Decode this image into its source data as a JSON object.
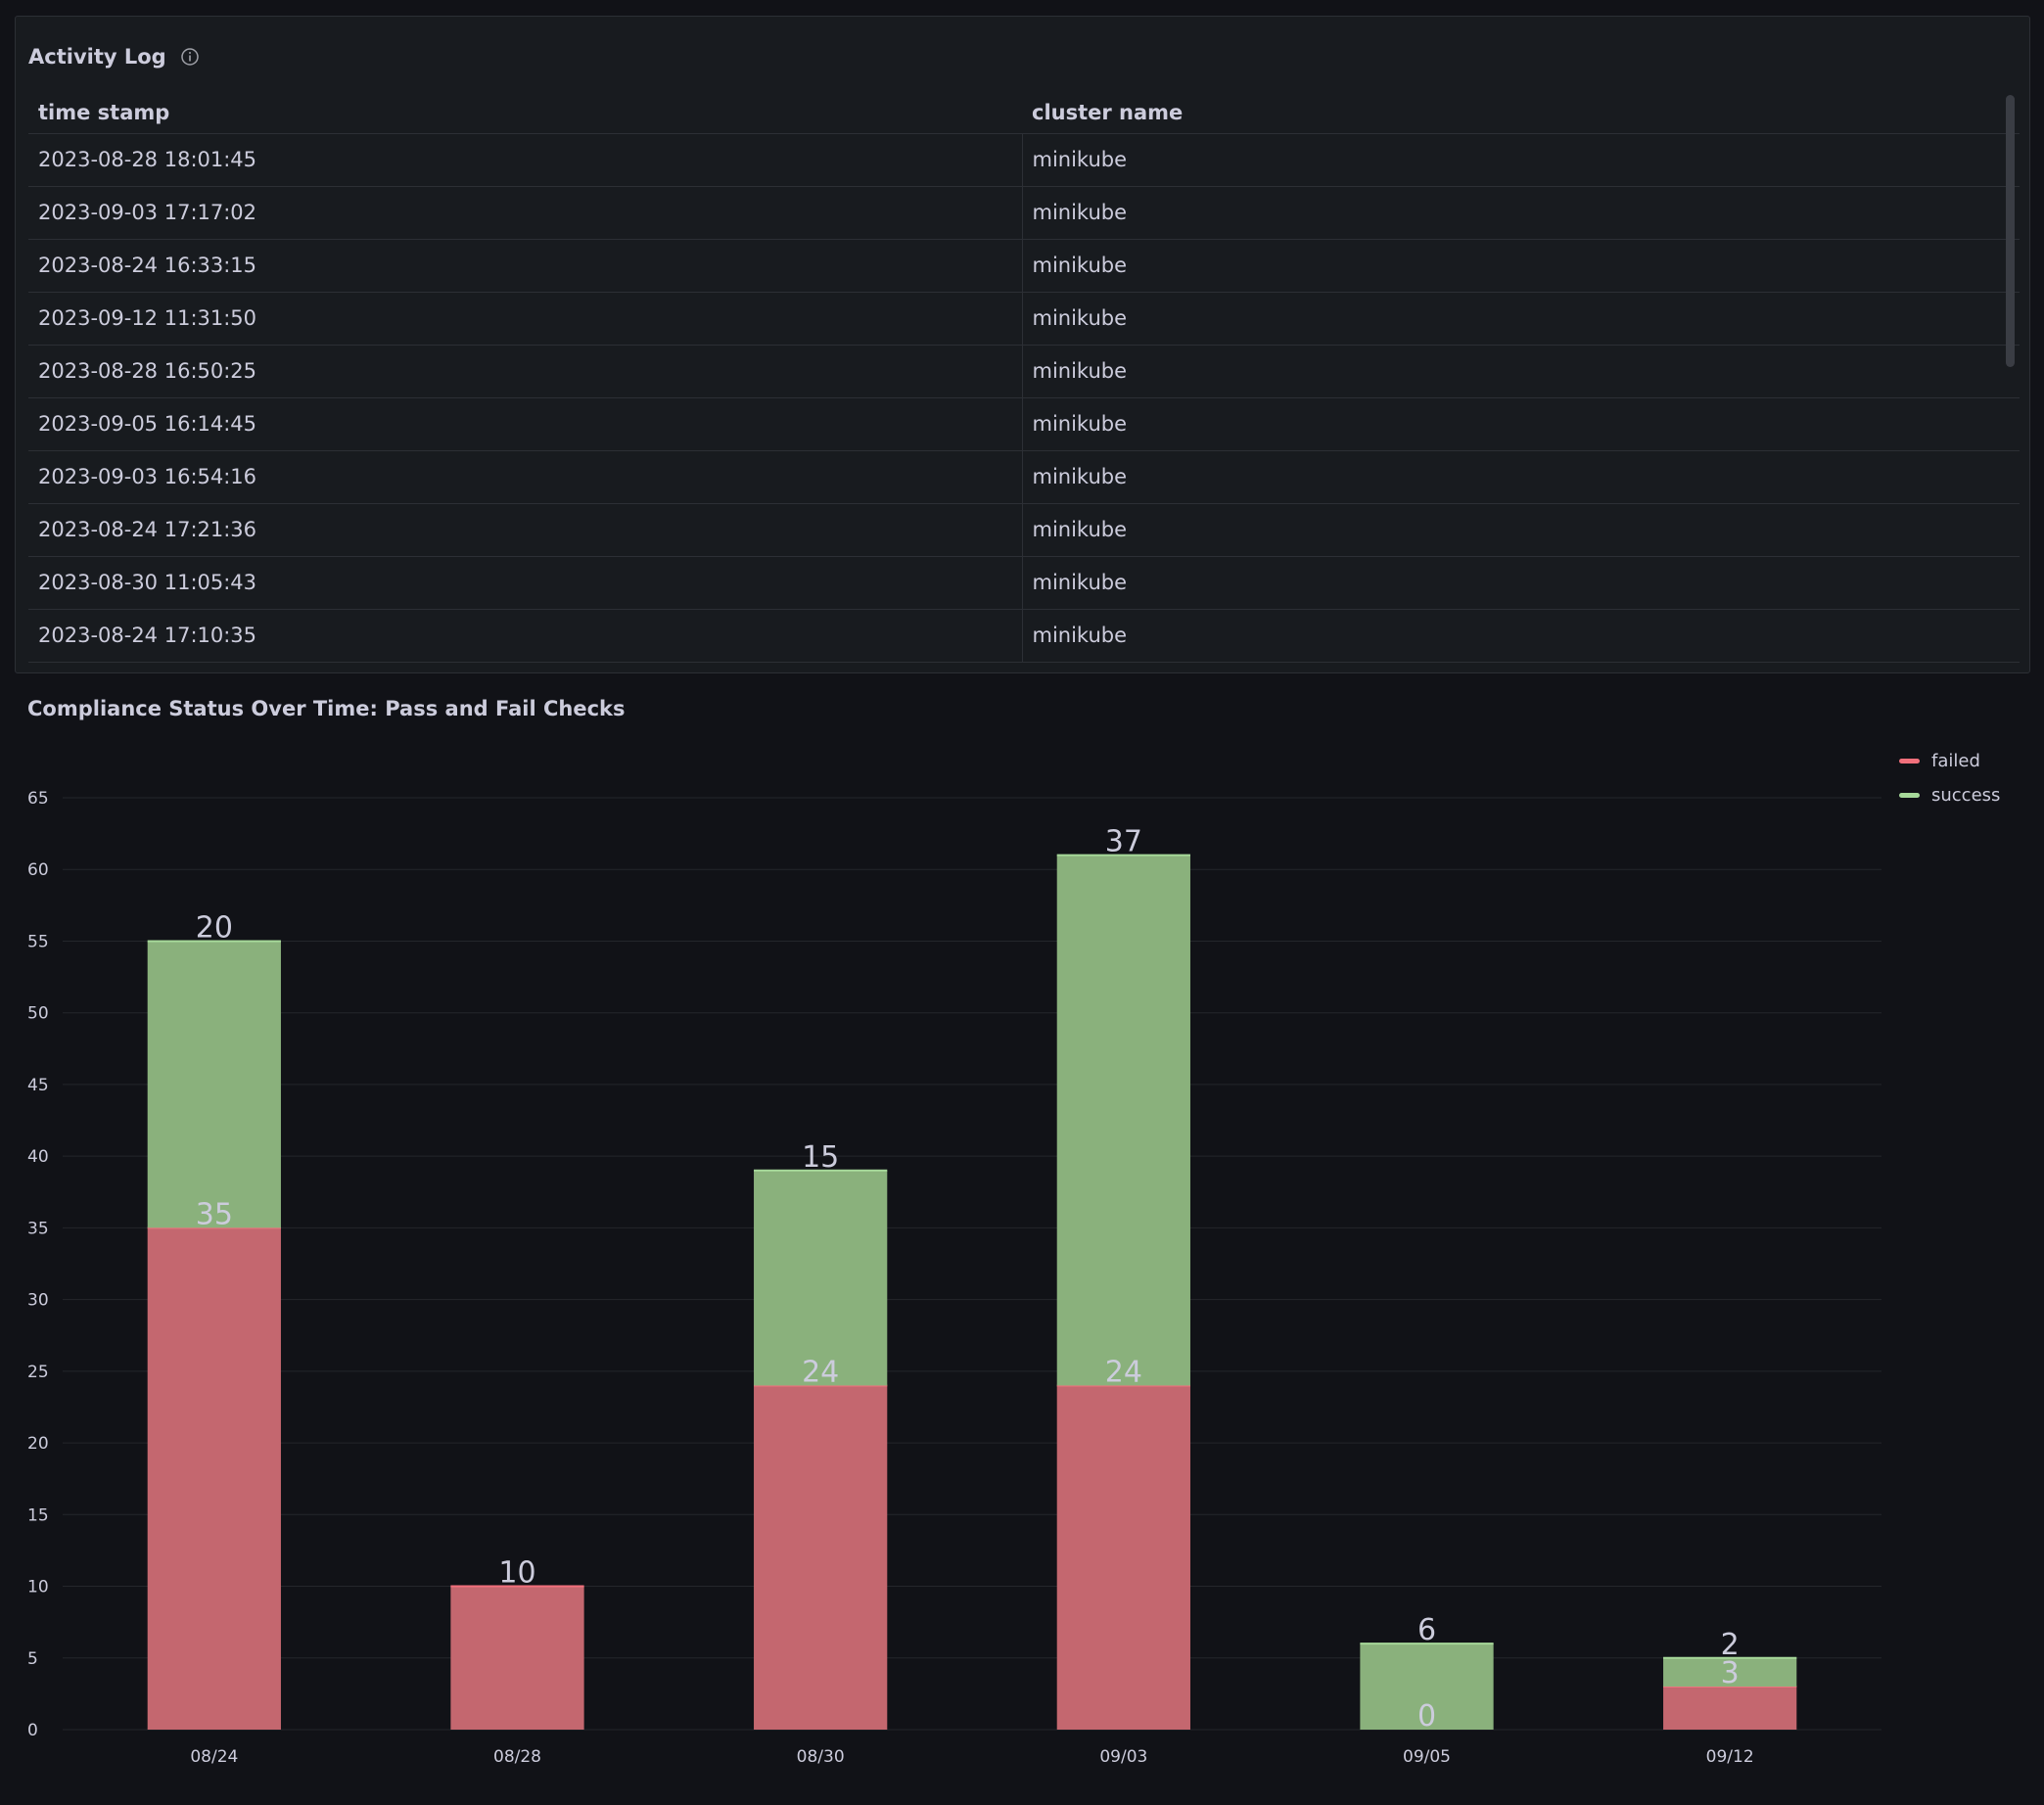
{
  "activity_panel": {
    "title": "Activity Log",
    "columns": [
      "time stamp",
      "cluster name"
    ],
    "rows": [
      [
        "2023-08-28 18:01:45",
        "minikube"
      ],
      [
        "2023-09-03 17:17:02",
        "minikube"
      ],
      [
        "2023-08-24 16:33:15",
        "minikube"
      ],
      [
        "2023-09-12 11:31:50",
        "minikube"
      ],
      [
        "2023-08-28 16:50:25",
        "minikube"
      ],
      [
        "2023-09-05 16:14:45",
        "minikube"
      ],
      [
        "2023-09-03 16:54:16",
        "minikube"
      ],
      [
        "2023-08-24 17:21:36",
        "minikube"
      ],
      [
        "2023-08-30 11:05:43",
        "minikube"
      ],
      [
        "2023-08-24 17:10:35",
        "minikube"
      ]
    ]
  },
  "colors": {
    "failed": "#c4676f",
    "failed_line": "#f2707c",
    "success": "#8ab17c",
    "success_line": "#a7d99a",
    "grid": "#24262b",
    "text": "#ccccdc"
  },
  "chart_data": {
    "type": "bar",
    "stacked": true,
    "title": "Compliance Status Over Time: Pass and Fail Checks",
    "categories": [
      "08/24",
      "08/28",
      "08/30",
      "09/03",
      "09/05",
      "09/12"
    ],
    "series": [
      {
        "name": "failed",
        "values": [
          35,
          10,
          24,
          24,
          0,
          3
        ]
      },
      {
        "name": "success",
        "values": [
          20,
          0,
          15,
          37,
          6,
          2
        ]
      }
    ],
    "yticks": [
      0,
      5,
      10,
      15,
      20,
      25,
      30,
      35,
      40,
      45,
      50,
      55,
      60,
      65
    ],
    "ylim": [
      0,
      65
    ],
    "grid": true,
    "legend": "top-right"
  }
}
